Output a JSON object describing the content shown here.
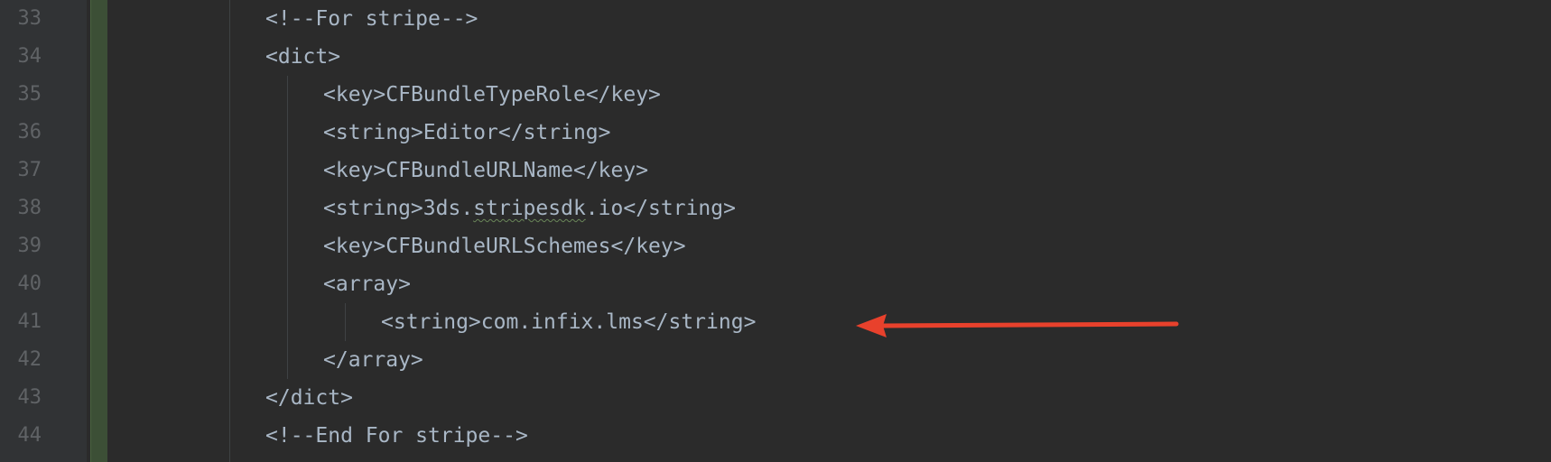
{
  "editor": {
    "lines": [
      {
        "number": "33",
        "indent": 3,
        "parts": [
          {
            "t": "<!--For stripe-->",
            "k": "comment"
          }
        ]
      },
      {
        "number": "34",
        "indent": 3,
        "parts": [
          {
            "t": "<dict>",
            "k": "tag"
          }
        ]
      },
      {
        "number": "35",
        "indent": 4,
        "parts": [
          {
            "t": "<key>",
            "k": "tag"
          },
          {
            "t": "CFBundleTypeRole",
            "k": "text"
          },
          {
            "t": "</key>",
            "k": "tag"
          }
        ]
      },
      {
        "number": "36",
        "indent": 4,
        "parts": [
          {
            "t": "<string>",
            "k": "tag"
          },
          {
            "t": "Editor",
            "k": "text"
          },
          {
            "t": "</string>",
            "k": "tag"
          }
        ]
      },
      {
        "number": "37",
        "indent": 4,
        "parts": [
          {
            "t": "<key>",
            "k": "tag"
          },
          {
            "t": "CFBundleURLName",
            "k": "text"
          },
          {
            "t": "</key>",
            "k": "tag"
          }
        ]
      },
      {
        "number": "38",
        "indent": 4,
        "parts": [
          {
            "t": "<string>",
            "k": "tag"
          },
          {
            "t": "3ds.",
            "k": "text"
          },
          {
            "t": "stripesdk",
            "k": "squiggle"
          },
          {
            "t": ".io",
            "k": "text"
          },
          {
            "t": "</string>",
            "k": "tag"
          }
        ]
      },
      {
        "number": "39",
        "indent": 4,
        "parts": [
          {
            "t": "<key>",
            "k": "tag"
          },
          {
            "t": "CFBundleURLSchemes",
            "k": "text"
          },
          {
            "t": "</key>",
            "k": "tag"
          }
        ]
      },
      {
        "number": "40",
        "indent": 4,
        "parts": [
          {
            "t": "<array>",
            "k": "tag"
          }
        ]
      },
      {
        "number": "41",
        "indent": 5,
        "parts": [
          {
            "t": "<string>",
            "k": "tag"
          },
          {
            "t": "com.infix.lms",
            "k": "text"
          },
          {
            "t": "</string>",
            "k": "tag"
          }
        ]
      },
      {
        "number": "42",
        "indent": 4,
        "parts": [
          {
            "t": "</array>",
            "k": "tag"
          }
        ]
      },
      {
        "number": "43",
        "indent": 3,
        "parts": [
          {
            "t": "</dict>",
            "k": "tag"
          }
        ]
      },
      {
        "number": "44",
        "indent": 3,
        "parts": [
          {
            "t": "<!--End For stripe-->",
            "k": "comment"
          }
        ]
      }
    ],
    "annotation": {
      "target_line": "41",
      "icon": "red-arrow-left-icon",
      "color": "#e8412c"
    }
  }
}
